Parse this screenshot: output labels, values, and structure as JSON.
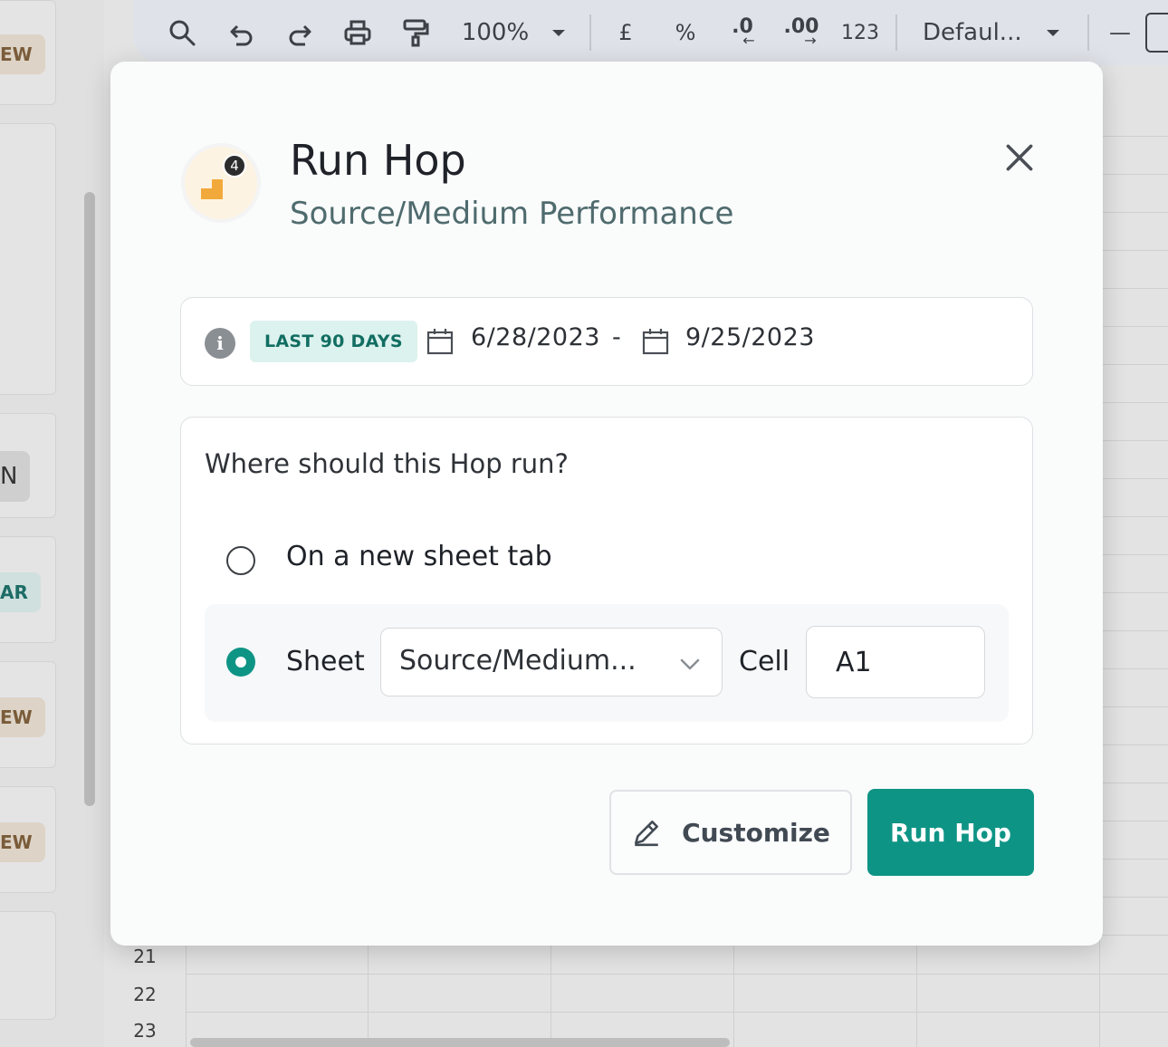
{
  "toolbar": {
    "zoom": "100%",
    "currency": "£",
    "percent": "%",
    "decrease_decimal": ".0",
    "increase_decimal": ".00",
    "number_format": "123",
    "font": "Defaul...",
    "minus": "—"
  },
  "side_panel": {
    "chips": [
      "EW",
      "N",
      "AR",
      "EW",
      "EW"
    ]
  },
  "sheet": {
    "row_numbers": [
      "21",
      "22",
      "23"
    ]
  },
  "dialog": {
    "title": "Run Hop",
    "subtitle": "Source/Medium Performance",
    "logo_badge": "4",
    "date_range": {
      "preset": "LAST 90 DAYS",
      "start": "6/28/2023",
      "separator": "-",
      "end": "9/25/2023"
    },
    "destination": {
      "question": "Where should this Hop run?",
      "option_new_tab": "On a new sheet tab",
      "option_sheet": "Sheet",
      "sheet_value": "Source/Medium...",
      "cell_label": "Cell",
      "cell_value": "A1",
      "selected": "sheet"
    },
    "buttons": {
      "customize": "Customize",
      "run": "Run Hop"
    }
  },
  "colors": {
    "accent": "#0e9485",
    "chip_bg": "#dcf2ee",
    "chip_text": "#126e62",
    "subtitle": "#4f6b6e"
  }
}
